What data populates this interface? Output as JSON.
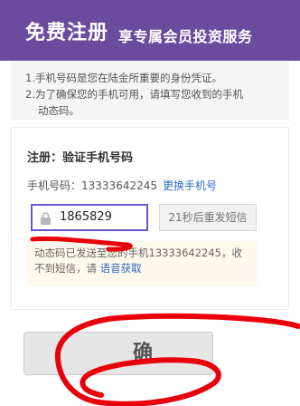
{
  "header": {
    "title": "免费注册",
    "subtitle": "享专属会员投资服务"
  },
  "notice": {
    "line1": "1.手机号码是您在陆金所重要的身份凭证。",
    "line2": "2.为了确保您的手机可用，请填写您收到的手机",
    "line3": "动态码。"
  },
  "form": {
    "title": "注册：验证手机号码",
    "phone_label": "手机号码：",
    "phone_number": "13333642245",
    "change_phone_link": "更换手机号",
    "code_value": "1865829",
    "resend_button": "21秒后重发短信",
    "sent_text_1": "动态码已发送至您的手机13333642245，收",
    "sent_text_2": "不到短信，请",
    "voice_link": "语音获取",
    "submit_partial": "确"
  },
  "colors": {
    "header_bg": "#6b4b9d",
    "link": "#2a6acb",
    "input_border": "#6a55c9",
    "annotation_red": "#e8000b"
  },
  "icons": {
    "lock": "lock-icon"
  }
}
